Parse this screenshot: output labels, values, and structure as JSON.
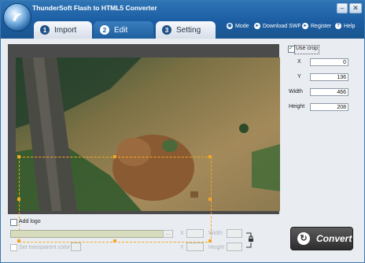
{
  "app": {
    "title": "ThunderSoft Flash to HTML5 Converter"
  },
  "window_controls": {
    "minimize": "–",
    "close": "✕"
  },
  "tabs": [
    {
      "num": "1",
      "label": "Import"
    },
    {
      "num": "2",
      "label": "Edit"
    },
    {
      "num": "3",
      "label": "Setting"
    }
  ],
  "topnav": [
    {
      "label": "Mode",
      "icon": "mode-icon"
    },
    {
      "label": "Download SWF",
      "icon": "download-icon"
    },
    {
      "label": "Register",
      "icon": "register-icon"
    },
    {
      "label": "Help",
      "icon": "help-icon"
    }
  ],
  "crop": {
    "use_crop_label": "Use crop",
    "use_crop_checked": true,
    "x_label": "X",
    "x_value": "0",
    "y_label": "Y",
    "y_value": "136",
    "width_label": "Width",
    "width_value": "466",
    "height_label": "Height",
    "height_value": "208"
  },
  "logo": {
    "add_logo_label": "Add logo",
    "browse_label": "...",
    "transparent_label": "Set transparent color",
    "width_label": "Width",
    "height_label": "Height"
  },
  "convert": {
    "label": "Convert"
  },
  "colors": {
    "accent": "#1c5da2",
    "crop_outline": "#f5a623"
  }
}
